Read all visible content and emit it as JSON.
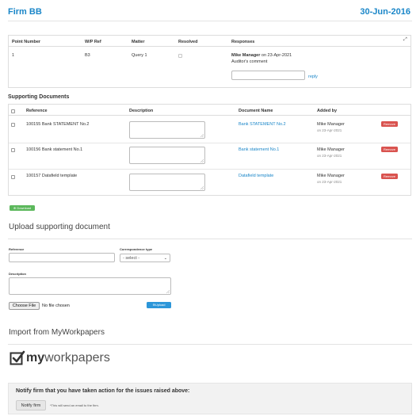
{
  "header": {
    "title": "Firm BB",
    "date": "30-Jun-2016"
  },
  "points_table": {
    "columns": [
      "Point Number",
      "W/P Ref",
      "Matter",
      "Resolved",
      "Responses"
    ],
    "row": {
      "point_number": "1",
      "wp_ref": "B3",
      "matter": "Query 1",
      "response_author": "Mike Manager",
      "response_date_text": "on 23-Apr-2021",
      "response_comment": "Auditor's comment",
      "reply_label": "reply",
      "reply_input_value": ""
    }
  },
  "supporting_documents": {
    "title": "Supporting Documents",
    "columns": [
      "Reference",
      "Description",
      "Document Name",
      "Added by"
    ],
    "rows": [
      {
        "reference": "100155  Bank STATEMENT No.2",
        "document_name": "Bank STATEMENT No.2",
        "added_by": "Mike Manager",
        "added_on": "on 23-Apr-2021",
        "remove_label": "Remove"
      },
      {
        "reference": "100156  Bank statement No.1",
        "document_name": "Bank statement No.1",
        "added_by": "Mike Manager",
        "added_on": "on 23-Apr-2021",
        "remove_label": "Remove"
      },
      {
        "reference": "100157  Datafield template",
        "document_name": "Datafield template",
        "added_by": "Mike Manager",
        "added_on": "on 23-Apr-2021",
        "remove_label": "Remove"
      }
    ],
    "download_label": "Download"
  },
  "upload": {
    "title": "Upload supporting document",
    "reference_label": "Reference",
    "reference_value": "",
    "correspondence_label": "Correspondence type",
    "correspondence_selected": "- select -",
    "description_label": "Description",
    "description_value": "",
    "choose_file_label": "Choose File",
    "no_file_text": "No file chosen",
    "upload_label": "Upload"
  },
  "import": {
    "title": "Import from MyWorkpapers",
    "logo_bold": "my",
    "logo_light": "workpapers"
  },
  "notify": {
    "title": "Notify firm that you have taken action for the issues raised above:",
    "button_label": "Notify firm",
    "note": "*This will send an email to the firm."
  },
  "colors": {
    "accent": "#1a86c8",
    "remove": "#d9534f",
    "download": "#5cb85c",
    "upload": "#2c96d9"
  }
}
